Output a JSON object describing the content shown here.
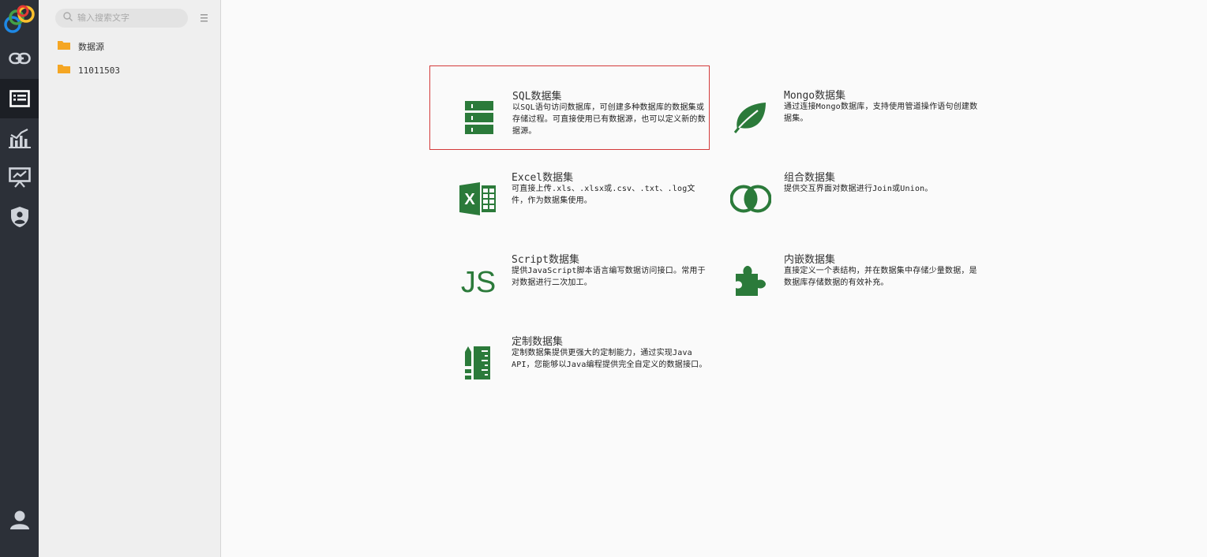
{
  "sidebar": {
    "nav": [
      {
        "icon": "link-icon"
      },
      {
        "icon": "dataset-list-icon"
      },
      {
        "icon": "chart-analysis-icon"
      },
      {
        "icon": "presentation-icon"
      },
      {
        "icon": "shield-user-icon"
      }
    ],
    "bottom_icon": "user-icon"
  },
  "tree": {
    "search_placeholder": "输入搜索文字",
    "items": [
      {
        "label": "数据源"
      },
      {
        "label": "11011503"
      }
    ]
  },
  "cards": [
    {
      "title": "SQL数据集",
      "desc": "以SQL语句访问数据库，可创建多种数据库的数据集或存储过程。可直接使用已有数据源，也可以定义新的数据源。",
      "icon": "database-table-icon"
    },
    {
      "title": "Mongo数据集",
      "desc": "通过连接Mongo数据库，支持使用管道操作语句创建数据集。",
      "icon": "leaf-icon"
    },
    {
      "title": "Excel数据集",
      "desc": "可直接上传.xls、.xlsx或.csv、.txt、.log文件，作为数据集使用。",
      "icon": "excel-icon"
    },
    {
      "title": "组合数据集",
      "desc": "提供交互界面对数据进行Join或Union。",
      "icon": "overlap-circles-icon"
    },
    {
      "title": "Script数据集",
      "desc": "提供JavaScript脚本语言编写数据访问接口。常用于对数据进行二次加工。",
      "icon": "js-icon"
    },
    {
      "title": "内嵌数据集",
      "desc": "直接定义一个表结构，并在数据集中存储少量数据，是数据库存储数据的有效补充。",
      "icon": "puzzle-icon"
    },
    {
      "title": "定制数据集",
      "desc": "定制数据集提供更强大的定制能力，通过实现Java API，您能够以Java编程提供完全自定义的数据接口。",
      "icon": "custom-ruler-icon"
    }
  ],
  "colors": {
    "accent": "#2b7a3a",
    "rail": "#2c3038",
    "selected_border": "#d33a3a",
    "folder": "#f5a623"
  }
}
